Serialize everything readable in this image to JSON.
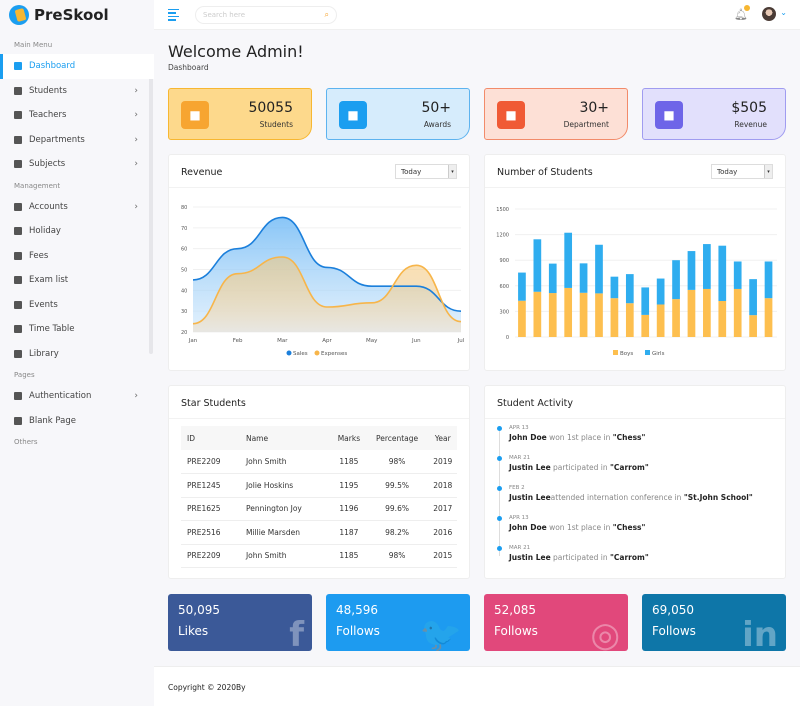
{
  "app": {
    "name": "PreSkool"
  },
  "topbar": {
    "search_placeholder": "Search here",
    "notification_count": "1"
  },
  "sidebar": {
    "sections": [
      {
        "title": "Main Menu",
        "items": [
          {
            "label": "Dashboard",
            "icon": "dashboard-icon",
            "active": true,
            "chevron": false
          },
          {
            "label": "Students",
            "icon": "student-icon",
            "chevron": true
          },
          {
            "label": "Teachers",
            "icon": "teacher-icon",
            "chevron": true
          },
          {
            "label": "Departments",
            "icon": "building-icon",
            "chevron": true
          },
          {
            "label": "Subjects",
            "icon": "book-icon",
            "chevron": true
          }
        ]
      },
      {
        "title": "Management",
        "items": [
          {
            "label": "Accounts",
            "icon": "invoice-icon",
            "chevron": true
          },
          {
            "label": "Holiday",
            "icon": "holiday-icon"
          },
          {
            "label": "Fees",
            "icon": "comment-dollar-icon"
          },
          {
            "label": "Exam list",
            "icon": "clipboard-icon"
          },
          {
            "label": "Events",
            "icon": "calendar-icon"
          },
          {
            "label": "Time Table",
            "icon": "table-icon"
          },
          {
            "label": "Library",
            "icon": "library-icon"
          }
        ]
      },
      {
        "title": "Pages",
        "items": [
          {
            "label": "Authentication",
            "icon": "shield-icon",
            "chevron": true
          },
          {
            "label": "Blank Page",
            "icon": "file-icon"
          }
        ]
      },
      {
        "title": "Others",
        "items": []
      }
    ]
  },
  "page": {
    "title": "Welcome Admin!",
    "breadcrumb": "Dashboard"
  },
  "stats": [
    {
      "value": "50055",
      "label": "Students",
      "icon": "graduate-icon",
      "bg": "#fdd98c",
      "border": "#f7b731",
      "icon_bg": "#f7a531"
    },
    {
      "value": "50+",
      "label": "Awards",
      "icon": "crown-icon",
      "bg": "#d6ecfc",
      "border": "#5db3ef",
      "icon_bg": "#1b9ef0"
    },
    {
      "value": "30+",
      "label": "Department",
      "icon": "building-icon",
      "bg": "#fde0d6",
      "border": "#f28b6a",
      "icon_bg": "#f05a35"
    },
    {
      "value": "$505",
      "label": "Revenue",
      "icon": "file-dollar-icon",
      "bg": "#e2e0fc",
      "border": "#a09cf0",
      "icon_bg": "#6e65e8"
    }
  ],
  "revenue_card": {
    "title": "Revenue",
    "select": "Today"
  },
  "students_card": {
    "title": "Number of Students",
    "select": "Today"
  },
  "chart_data": [
    {
      "type": "area",
      "title": "Revenue",
      "categories": [
        "Jan",
        "Feb",
        "Mar",
        "Apr",
        "May",
        "Jun",
        "Jul"
      ],
      "series": [
        {
          "name": "Sales",
          "color": "#1b7fdb",
          "values": [
            45,
            60,
            75,
            51,
            42,
            42,
            30
          ]
        },
        {
          "name": "Expenses",
          "color": "#f7b54a",
          "values": [
            24,
            48,
            56,
            32,
            34,
            52,
            25
          ]
        }
      ],
      "ylim": [
        20,
        80
      ],
      "yticks": [
        20,
        30,
        40,
        50,
        60,
        70,
        80
      ],
      "grid": true,
      "legend": "bottom"
    },
    {
      "type": "bar",
      "stacked": true,
      "title": "Number of Students",
      "series": [
        {
          "name": "Boys",
          "color": "#fdbf4f",
          "values": [
            425,
            530,
            515,
            575,
            518,
            511,
            455,
            396,
            259,
            381,
            444,
            552,
            563,
            422,
            563,
            256,
            455
          ]
        },
        {
          "name": "Girls",
          "color": "#2fadef",
          "values": [
            330,
            615,
            345,
            647,
            345,
            570,
            252,
            341,
            322,
            304,
            456,
            455,
            526,
            648,
            322,
            422,
            430
          ]
        }
      ],
      "ylim": [
        0,
        1500
      ],
      "yticks": [
        0,
        300,
        600,
        900,
        1200,
        1500
      ],
      "grid": true,
      "legend": "bottom"
    }
  ],
  "star_students": {
    "title": "Star Students",
    "headers": [
      "ID",
      "Name",
      "Marks",
      "Percentage",
      "Year"
    ],
    "rows": [
      [
        "PRE2209",
        "John Smith",
        "1185",
        "98%",
        "2019"
      ],
      [
        "PRE1245",
        "Jolie Hoskins",
        "1195",
        "99.5%",
        "2018"
      ],
      [
        "PRE1625",
        "Pennington Joy",
        "1196",
        "99.6%",
        "2017"
      ],
      [
        "PRE2516",
        "Millie Marsden",
        "1187",
        "98.2%",
        "2016"
      ],
      [
        "PRE2209",
        "John Smith",
        "1185",
        "98%",
        "2015"
      ]
    ]
  },
  "activity": {
    "title": "Student Activity",
    "items": [
      {
        "date": "APR 13",
        "name": "John Doe",
        "text": " won 1st place in ",
        "target": "\"Chess\""
      },
      {
        "date": "MAR 21",
        "name": "Justin Lee",
        "text": " participated in ",
        "target": "\"Carrom\""
      },
      {
        "date": "FEB 2",
        "name": "Justin Lee",
        "text": "attended internation conference in ",
        "target": "\"St.John School\""
      },
      {
        "date": "APR 13",
        "name": "John Doe",
        "text": " won 1st place in ",
        "target": "\"Chess\""
      },
      {
        "date": "MAR 21",
        "name": "Justin Lee",
        "text": " participated in ",
        "target": "\"Carrom\""
      }
    ]
  },
  "social": [
    {
      "value": "50,095",
      "label": "Likes",
      "icon": "facebook-icon",
      "glyph": "f",
      "bg": "#3b5998"
    },
    {
      "value": "48,596",
      "label": "Follows",
      "icon": "twitter-icon",
      "glyph": "🐦",
      "bg": "#1d9bf0"
    },
    {
      "value": "52,085",
      "label": "Follows",
      "icon": "instagram-icon",
      "glyph": "◎",
      "bg": "#e1487b"
    },
    {
      "value": "69,050",
      "label": "Follows",
      "icon": "linkedin-icon",
      "glyph": "in",
      "bg": "#0e76a8"
    }
  ],
  "footer": {
    "text": "Copyright © 2020By"
  }
}
